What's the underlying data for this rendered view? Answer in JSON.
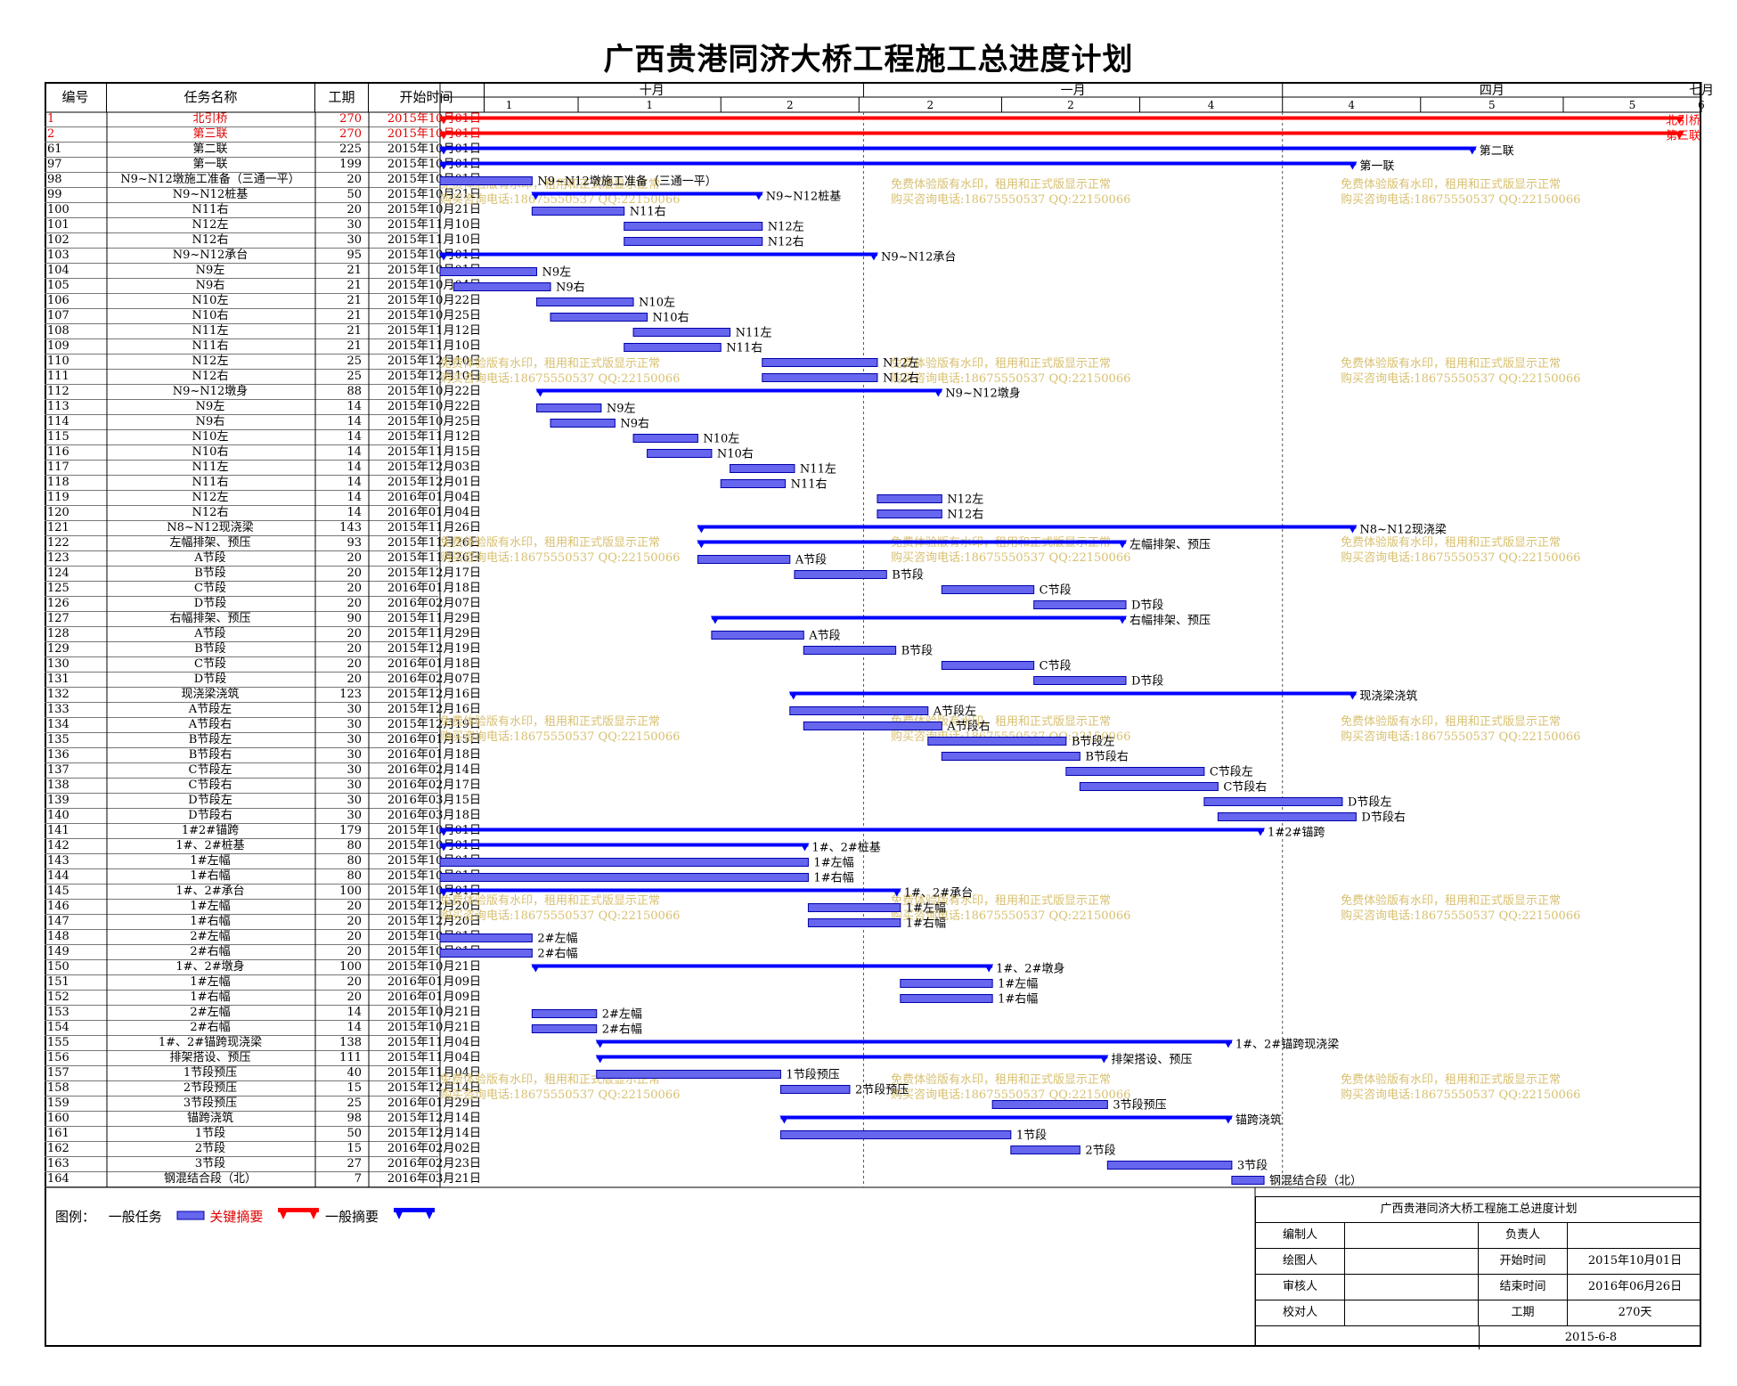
{
  "title": "广西贵港同济大桥工程施工总进度计划",
  "headers": {
    "id": "编号",
    "name": "任务名称",
    "dur": "工期",
    "start": "开始时间"
  },
  "timescale": {
    "months": [
      "十月",
      "一月",
      "四月",
      "七月"
    ],
    "month_end_days": [
      0,
      92,
      183,
      274
    ],
    "units": [
      "1",
      "1",
      "2",
      "2",
      "2",
      "4",
      "4",
      "5",
      "5",
      "6"
    ],
    "unit_days": [
      0,
      30,
      61,
      91,
      122,
      152,
      183,
      213,
      244,
      274
    ]
  },
  "watermark": {
    "line1": "免费体验版有水印，租用和正式版显示正常",
    "line2": "购买咨询电话:18675550537 QQ:22150066"
  },
  "colors": {
    "normal": "#0000ff",
    "critical": "#ff0000",
    "bar_fill": "#6666ee",
    "watermark": "#d8c070"
  },
  "chart_data": {
    "type": "gantt",
    "project_start": "2015-10-01",
    "project_end": "2016-06-26",
    "tasks": [
      {
        "id": "1",
        "name": "北引桥",
        "dur": 270,
        "start": "2015年10月01日",
        "s": 0,
        "kind": "crit",
        "label": "北引桥"
      },
      {
        "id": "2",
        "name": "第三联",
        "dur": 270,
        "start": "2015年10月01日",
        "s": 0,
        "kind": "crit",
        "label": "第三联"
      },
      {
        "id": "61",
        "name": "第二联",
        "dur": 225,
        "start": "2015年10月01日",
        "s": 0,
        "kind": "sum",
        "label": "第二联"
      },
      {
        "id": "97",
        "name": "第一联",
        "dur": 199,
        "start": "2015年10月01日",
        "s": 0,
        "kind": "sum",
        "label": "第一联"
      },
      {
        "id": "98",
        "name": "N9~N12墩施工准备（三通一平）",
        "dur": 20,
        "start": "2015年10月01日",
        "s": 0,
        "kind": "task",
        "label": "N9~N12墩施工准备（三通一平）"
      },
      {
        "id": "99",
        "name": "N9~N12桩基",
        "dur": 50,
        "start": "2015年10月21日",
        "s": 20,
        "kind": "sum",
        "label": "N9~N12桩基"
      },
      {
        "id": "100",
        "name": "N11右",
        "dur": 20,
        "start": "2015年10月21日",
        "s": 20,
        "kind": "task",
        "label": "N11右"
      },
      {
        "id": "101",
        "name": "N12左",
        "dur": 30,
        "start": "2015年11月10日",
        "s": 40,
        "kind": "task",
        "label": "N12左"
      },
      {
        "id": "102",
        "name": "N12右",
        "dur": 30,
        "start": "2015年11月10日",
        "s": 40,
        "kind": "task",
        "label": "N12右"
      },
      {
        "id": "103",
        "name": "N9~N12承台",
        "dur": 95,
        "start": "2015年10月01日",
        "s": 0,
        "kind": "sum",
        "label": "N9~N12承台"
      },
      {
        "id": "104",
        "name": "N9左",
        "dur": 21,
        "start": "2015年10月01日",
        "s": 0,
        "kind": "task",
        "label": "N9左"
      },
      {
        "id": "105",
        "name": "N9右",
        "dur": 21,
        "start": "2015年10月04日",
        "s": 3,
        "kind": "task",
        "label": "N9右"
      },
      {
        "id": "106",
        "name": "N10左",
        "dur": 21,
        "start": "2015年10月22日",
        "s": 21,
        "kind": "task",
        "label": "N10左"
      },
      {
        "id": "107",
        "name": "N10右",
        "dur": 21,
        "start": "2015年10月25日",
        "s": 24,
        "kind": "task",
        "label": "N10右"
      },
      {
        "id": "108",
        "name": "N11左",
        "dur": 21,
        "start": "2015年11月12日",
        "s": 42,
        "kind": "task",
        "label": "N11左"
      },
      {
        "id": "109",
        "name": "N11右",
        "dur": 21,
        "start": "2015年11月10日",
        "s": 40,
        "kind": "task",
        "label": "N11右"
      },
      {
        "id": "110",
        "name": "N12左",
        "dur": 25,
        "start": "2015年12月10日",
        "s": 70,
        "kind": "task",
        "label": "N12左"
      },
      {
        "id": "111",
        "name": "N12右",
        "dur": 25,
        "start": "2015年12月10日",
        "s": 70,
        "kind": "task",
        "label": "N12右"
      },
      {
        "id": "112",
        "name": "N9~N12墩身",
        "dur": 88,
        "start": "2015年10月22日",
        "s": 21,
        "kind": "sum",
        "label": "N9~N12墩身"
      },
      {
        "id": "113",
        "name": "N9左",
        "dur": 14,
        "start": "2015年10月22日",
        "s": 21,
        "kind": "task",
        "label": "N9左"
      },
      {
        "id": "114",
        "name": "N9右",
        "dur": 14,
        "start": "2015年10月25日",
        "s": 24,
        "kind": "task",
        "label": "N9右"
      },
      {
        "id": "115",
        "name": "N10左",
        "dur": 14,
        "start": "2015年11月12日",
        "s": 42,
        "kind": "task",
        "label": "N10左"
      },
      {
        "id": "116",
        "name": "N10右",
        "dur": 14,
        "start": "2015年11月15日",
        "s": 45,
        "kind": "task",
        "label": "N10右"
      },
      {
        "id": "117",
        "name": "N11左",
        "dur": 14,
        "start": "2015年12月03日",
        "s": 63,
        "kind": "task",
        "label": "N11左"
      },
      {
        "id": "118",
        "name": "N11右",
        "dur": 14,
        "start": "2015年12月01日",
        "s": 61,
        "kind": "task",
        "label": "N11右"
      },
      {
        "id": "119",
        "name": "N12左",
        "dur": 14,
        "start": "2016年01月04日",
        "s": 95,
        "kind": "task",
        "label": "N12左"
      },
      {
        "id": "120",
        "name": "N12右",
        "dur": 14,
        "start": "2016年01月04日",
        "s": 95,
        "kind": "task",
        "label": "N12右"
      },
      {
        "id": "121",
        "name": "N8~N12现浇梁",
        "dur": 143,
        "start": "2015年11月26日",
        "s": 56,
        "kind": "sum",
        "label": "N8~N12现浇梁"
      },
      {
        "id": "122",
        "name": "左幅排架、预压",
        "dur": 93,
        "start": "2015年11月26日",
        "s": 56,
        "kind": "sum",
        "label": "左幅排架、预压"
      },
      {
        "id": "123",
        "name": "A节段",
        "dur": 20,
        "start": "2015年11月26日",
        "s": 56,
        "kind": "task",
        "label": "A节段"
      },
      {
        "id": "124",
        "name": "B节段",
        "dur": 20,
        "start": "2015年12月17日",
        "s": 77,
        "kind": "task",
        "label": "B节段"
      },
      {
        "id": "125",
        "name": "C节段",
        "dur": 20,
        "start": "2016年01月18日",
        "s": 109,
        "kind": "task",
        "label": "C节段"
      },
      {
        "id": "126",
        "name": "D节段",
        "dur": 20,
        "start": "2016年02月07日",
        "s": 129,
        "kind": "task",
        "label": "D节段"
      },
      {
        "id": "127",
        "name": "右幅排架、预压",
        "dur": 90,
        "start": "2015年11月29日",
        "s": 59,
        "kind": "sum",
        "label": "右幅排架、预压"
      },
      {
        "id": "128",
        "name": "A节段",
        "dur": 20,
        "start": "2015年11月29日",
        "s": 59,
        "kind": "task",
        "label": "A节段"
      },
      {
        "id": "129",
        "name": "B节段",
        "dur": 20,
        "start": "2015年12月19日",
        "s": 79,
        "kind": "task",
        "label": "B节段"
      },
      {
        "id": "130",
        "name": "C节段",
        "dur": 20,
        "start": "2016年01月18日",
        "s": 109,
        "kind": "task",
        "label": "C节段"
      },
      {
        "id": "131",
        "name": "D节段",
        "dur": 20,
        "start": "2016年02月07日",
        "s": 129,
        "kind": "task",
        "label": "D节段"
      },
      {
        "id": "132",
        "name": "现浇梁浇筑",
        "dur": 123,
        "start": "2015年12月16日",
        "s": 76,
        "kind": "sum",
        "label": "现浇梁浇筑"
      },
      {
        "id": "133",
        "name": "A节段左",
        "dur": 30,
        "start": "2015年12月16日",
        "s": 76,
        "kind": "task",
        "label": "A节段左"
      },
      {
        "id": "134",
        "name": "A节段右",
        "dur": 30,
        "start": "2015年12月19日",
        "s": 79,
        "kind": "task",
        "label": "A节段右"
      },
      {
        "id": "135",
        "name": "B节段左",
        "dur": 30,
        "start": "2016年01月15日",
        "s": 106,
        "kind": "task",
        "label": "B节段左"
      },
      {
        "id": "136",
        "name": "B节段右",
        "dur": 30,
        "start": "2016年01月18日",
        "s": 109,
        "kind": "task",
        "label": "B节段右"
      },
      {
        "id": "137",
        "name": "C节段左",
        "dur": 30,
        "start": "2016年02月14日",
        "s": 136,
        "kind": "task",
        "label": "C节段左"
      },
      {
        "id": "138",
        "name": "C节段右",
        "dur": 30,
        "start": "2016年02月17日",
        "s": 139,
        "kind": "task",
        "label": "C节段右"
      },
      {
        "id": "139",
        "name": "D节段左",
        "dur": 30,
        "start": "2016年03月15日",
        "s": 166,
        "kind": "task",
        "label": "D节段左"
      },
      {
        "id": "140",
        "name": "D节段右",
        "dur": 30,
        "start": "2016年03月18日",
        "s": 169,
        "kind": "task",
        "label": "D节段右"
      },
      {
        "id": "141",
        "name": "1#2#锚跨",
        "dur": 179,
        "start": "2015年10月01日",
        "s": 0,
        "kind": "sum",
        "label": "1#2#锚跨"
      },
      {
        "id": "142",
        "name": "1#、2#桩基",
        "dur": 80,
        "start": "2015年10月01日",
        "s": 0,
        "kind": "sum",
        "label": "1#、2#桩基"
      },
      {
        "id": "143",
        "name": "1#左幅",
        "dur": 80,
        "start": "2015年10月01日",
        "s": 0,
        "kind": "task",
        "label": "1#左幅"
      },
      {
        "id": "144",
        "name": "1#右幅",
        "dur": 80,
        "start": "2015年10月01日",
        "s": 0,
        "kind": "task",
        "label": "1#右幅"
      },
      {
        "id": "145",
        "name": "1#、2#承台",
        "dur": 100,
        "start": "2015年10月01日",
        "s": 0,
        "kind": "sum",
        "label": "1#、2#承台"
      },
      {
        "id": "146",
        "name": "1#左幅",
        "dur": 20,
        "start": "2015年12月20日",
        "s": 80,
        "kind": "task",
        "label": "1#左幅"
      },
      {
        "id": "147",
        "name": "1#右幅",
        "dur": 20,
        "start": "2015年12月20日",
        "s": 80,
        "kind": "task",
        "label": "1#右幅"
      },
      {
        "id": "148",
        "name": "2#左幅",
        "dur": 20,
        "start": "2015年10月01日",
        "s": 0,
        "kind": "task",
        "label": "2#左幅"
      },
      {
        "id": "149",
        "name": "2#右幅",
        "dur": 20,
        "start": "2015年10月01日",
        "s": 0,
        "kind": "task",
        "label": "2#右幅"
      },
      {
        "id": "150",
        "name": "1#、2#墩身",
        "dur": 100,
        "start": "2015年10月21日",
        "s": 20,
        "kind": "sum",
        "label": "1#、2#墩身"
      },
      {
        "id": "151",
        "name": "1#左幅",
        "dur": 20,
        "start": "2016年01月09日",
        "s": 100,
        "kind": "task",
        "label": "1#左幅"
      },
      {
        "id": "152",
        "name": "1#右幅",
        "dur": 20,
        "start": "2016年01月09日",
        "s": 100,
        "kind": "task",
        "label": "1#右幅"
      },
      {
        "id": "153",
        "name": "2#左幅",
        "dur": 14,
        "start": "2015年10月21日",
        "s": 20,
        "kind": "task",
        "label": "2#左幅"
      },
      {
        "id": "154",
        "name": "2#右幅",
        "dur": 14,
        "start": "2015年10月21日",
        "s": 20,
        "kind": "task",
        "label": "2#右幅"
      },
      {
        "id": "155",
        "name": "1#、2#锚跨现浇梁",
        "dur": 138,
        "start": "2015年11月04日",
        "s": 34,
        "kind": "sum",
        "label": "1#、2#锚跨现浇梁"
      },
      {
        "id": "156",
        "name": "排架搭设、预压",
        "dur": 111,
        "start": "2015年11月04日",
        "s": 34,
        "kind": "sum",
        "label": "排架搭设、预压"
      },
      {
        "id": "157",
        "name": "1节段预压",
        "dur": 40,
        "start": "2015年11月04日",
        "s": 34,
        "kind": "task",
        "label": "1节段预压"
      },
      {
        "id": "158",
        "name": "2节段预压",
        "dur": 15,
        "start": "2015年12月14日",
        "s": 74,
        "kind": "task",
        "label": "2节段预压"
      },
      {
        "id": "159",
        "name": "3节段预压",
        "dur": 25,
        "start": "2016年01月29日",
        "s": 120,
        "kind": "task",
        "label": "3节段预压"
      },
      {
        "id": "160",
        "name": "锚跨浇筑",
        "dur": 98,
        "start": "2015年12月14日",
        "s": 74,
        "kind": "sum",
        "label": "锚跨浇筑"
      },
      {
        "id": "161",
        "name": "1节段",
        "dur": 50,
        "start": "2015年12月14日",
        "s": 74,
        "kind": "task",
        "label": "1节段"
      },
      {
        "id": "162",
        "name": "2节段",
        "dur": 15,
        "start": "2016年02月02日",
        "s": 124,
        "kind": "task",
        "label": "2节段"
      },
      {
        "id": "163",
        "name": "3节段",
        "dur": 27,
        "start": "2016年02月23日",
        "s": 145,
        "kind": "task",
        "label": "3节段"
      },
      {
        "id": "164",
        "name": "钢混结合段（北）",
        "dur": 7,
        "start": "2016年03月21日",
        "s": 172,
        "kind": "task",
        "label": "钢混结合段（北）"
      }
    ]
  },
  "legend": {
    "prefix": "图例：",
    "normal_task": "一般任务",
    "critical_summary": "关键摘要",
    "normal_summary": "一般摘要"
  },
  "info": {
    "title": "广西贵港同济大桥工程施工总进度计划",
    "rows": [
      {
        "k1": "编制人",
        "v1": "",
        "k2": "负责人",
        "v2": ""
      },
      {
        "k1": "绘图人",
        "v1": "",
        "k2": "开始时间",
        "v2": "2015年10月01日"
      },
      {
        "k1": "审核人",
        "v1": "",
        "k2": "结束时间",
        "v2": "2016年06月26日"
      },
      {
        "k1": "校对人",
        "v1": "",
        "k2": "工期",
        "v2": "270天"
      }
    ],
    "date": "2015-6-8"
  }
}
